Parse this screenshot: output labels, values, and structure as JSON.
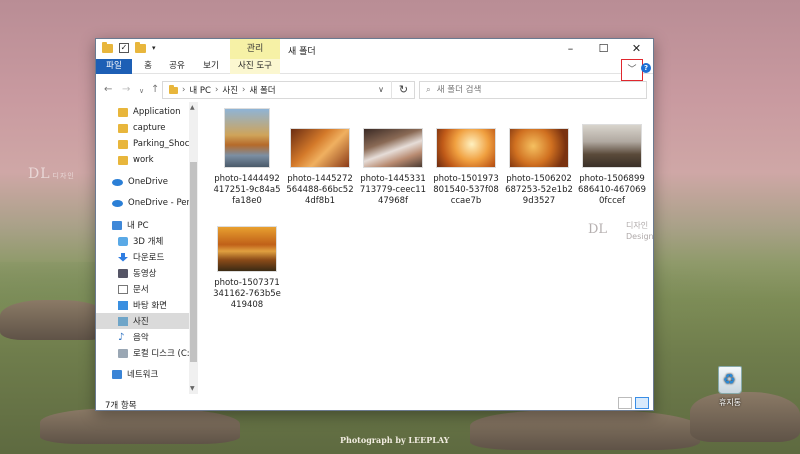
{
  "desktop": {
    "logo": "DL",
    "logo_small": "디자인",
    "watermark": "DL",
    "watermark_text": [
      "디자인",
      "Design"
    ],
    "credit": "Photograph by LEEPLAY",
    "recycle_label": "휴지통"
  },
  "window": {
    "context_tab": "관리",
    "title": "새 폴더",
    "ribbon_tabs": [
      "파일",
      "홈",
      "공유",
      "보기",
      "사진 도구"
    ],
    "address": [
      "내 PC",
      "사진",
      "새 폴더"
    ],
    "search_placeholder": "새 폴더 검색",
    "help": "?",
    "status": "7개 항목"
  },
  "nav": [
    {
      "label": "Application",
      "icon": "folder-icon"
    },
    {
      "label": "capture",
      "icon": "folder-icon"
    },
    {
      "label": "Parking_Shock",
      "icon": "folder-icon"
    },
    {
      "label": "work",
      "icon": "folder-icon"
    },
    {
      "label": "OneDrive",
      "icon": "cloud-icon"
    },
    {
      "label": "OneDrive - Persor",
      "icon": "cloud-icon"
    },
    {
      "label": "내 PC",
      "icon": "pc-icon"
    },
    {
      "label": "3D 개체",
      "icon": "3d-icon"
    },
    {
      "label": "다운로드",
      "icon": "download-icon"
    },
    {
      "label": "동영상",
      "icon": "video-icon"
    },
    {
      "label": "문서",
      "icon": "document-icon"
    },
    {
      "label": "바탕 화면",
      "icon": "desktop-icon"
    },
    {
      "label": "사진",
      "icon": "pictures-icon"
    },
    {
      "label": "음악",
      "icon": "music-icon"
    },
    {
      "label": "로컬 디스크 (C:)",
      "icon": "disk-icon"
    },
    {
      "label": "네트워크",
      "icon": "network-icon"
    }
  ],
  "files": [
    {
      "name": "photo-1444492417251-9c84a5fa18e0"
    },
    {
      "name": "photo-1445272564488-66bc524df8b1"
    },
    {
      "name": "photo-1445331713779-ceec1147968f"
    },
    {
      "name": "photo-1501973801540-537f08ccae7b"
    },
    {
      "name": "photo-1506202687253-52e1b29d3527"
    },
    {
      "name": "photo-1506899686410-4670690fccef"
    },
    {
      "name": "photo-1507371341162-763b5e419408"
    }
  ]
}
